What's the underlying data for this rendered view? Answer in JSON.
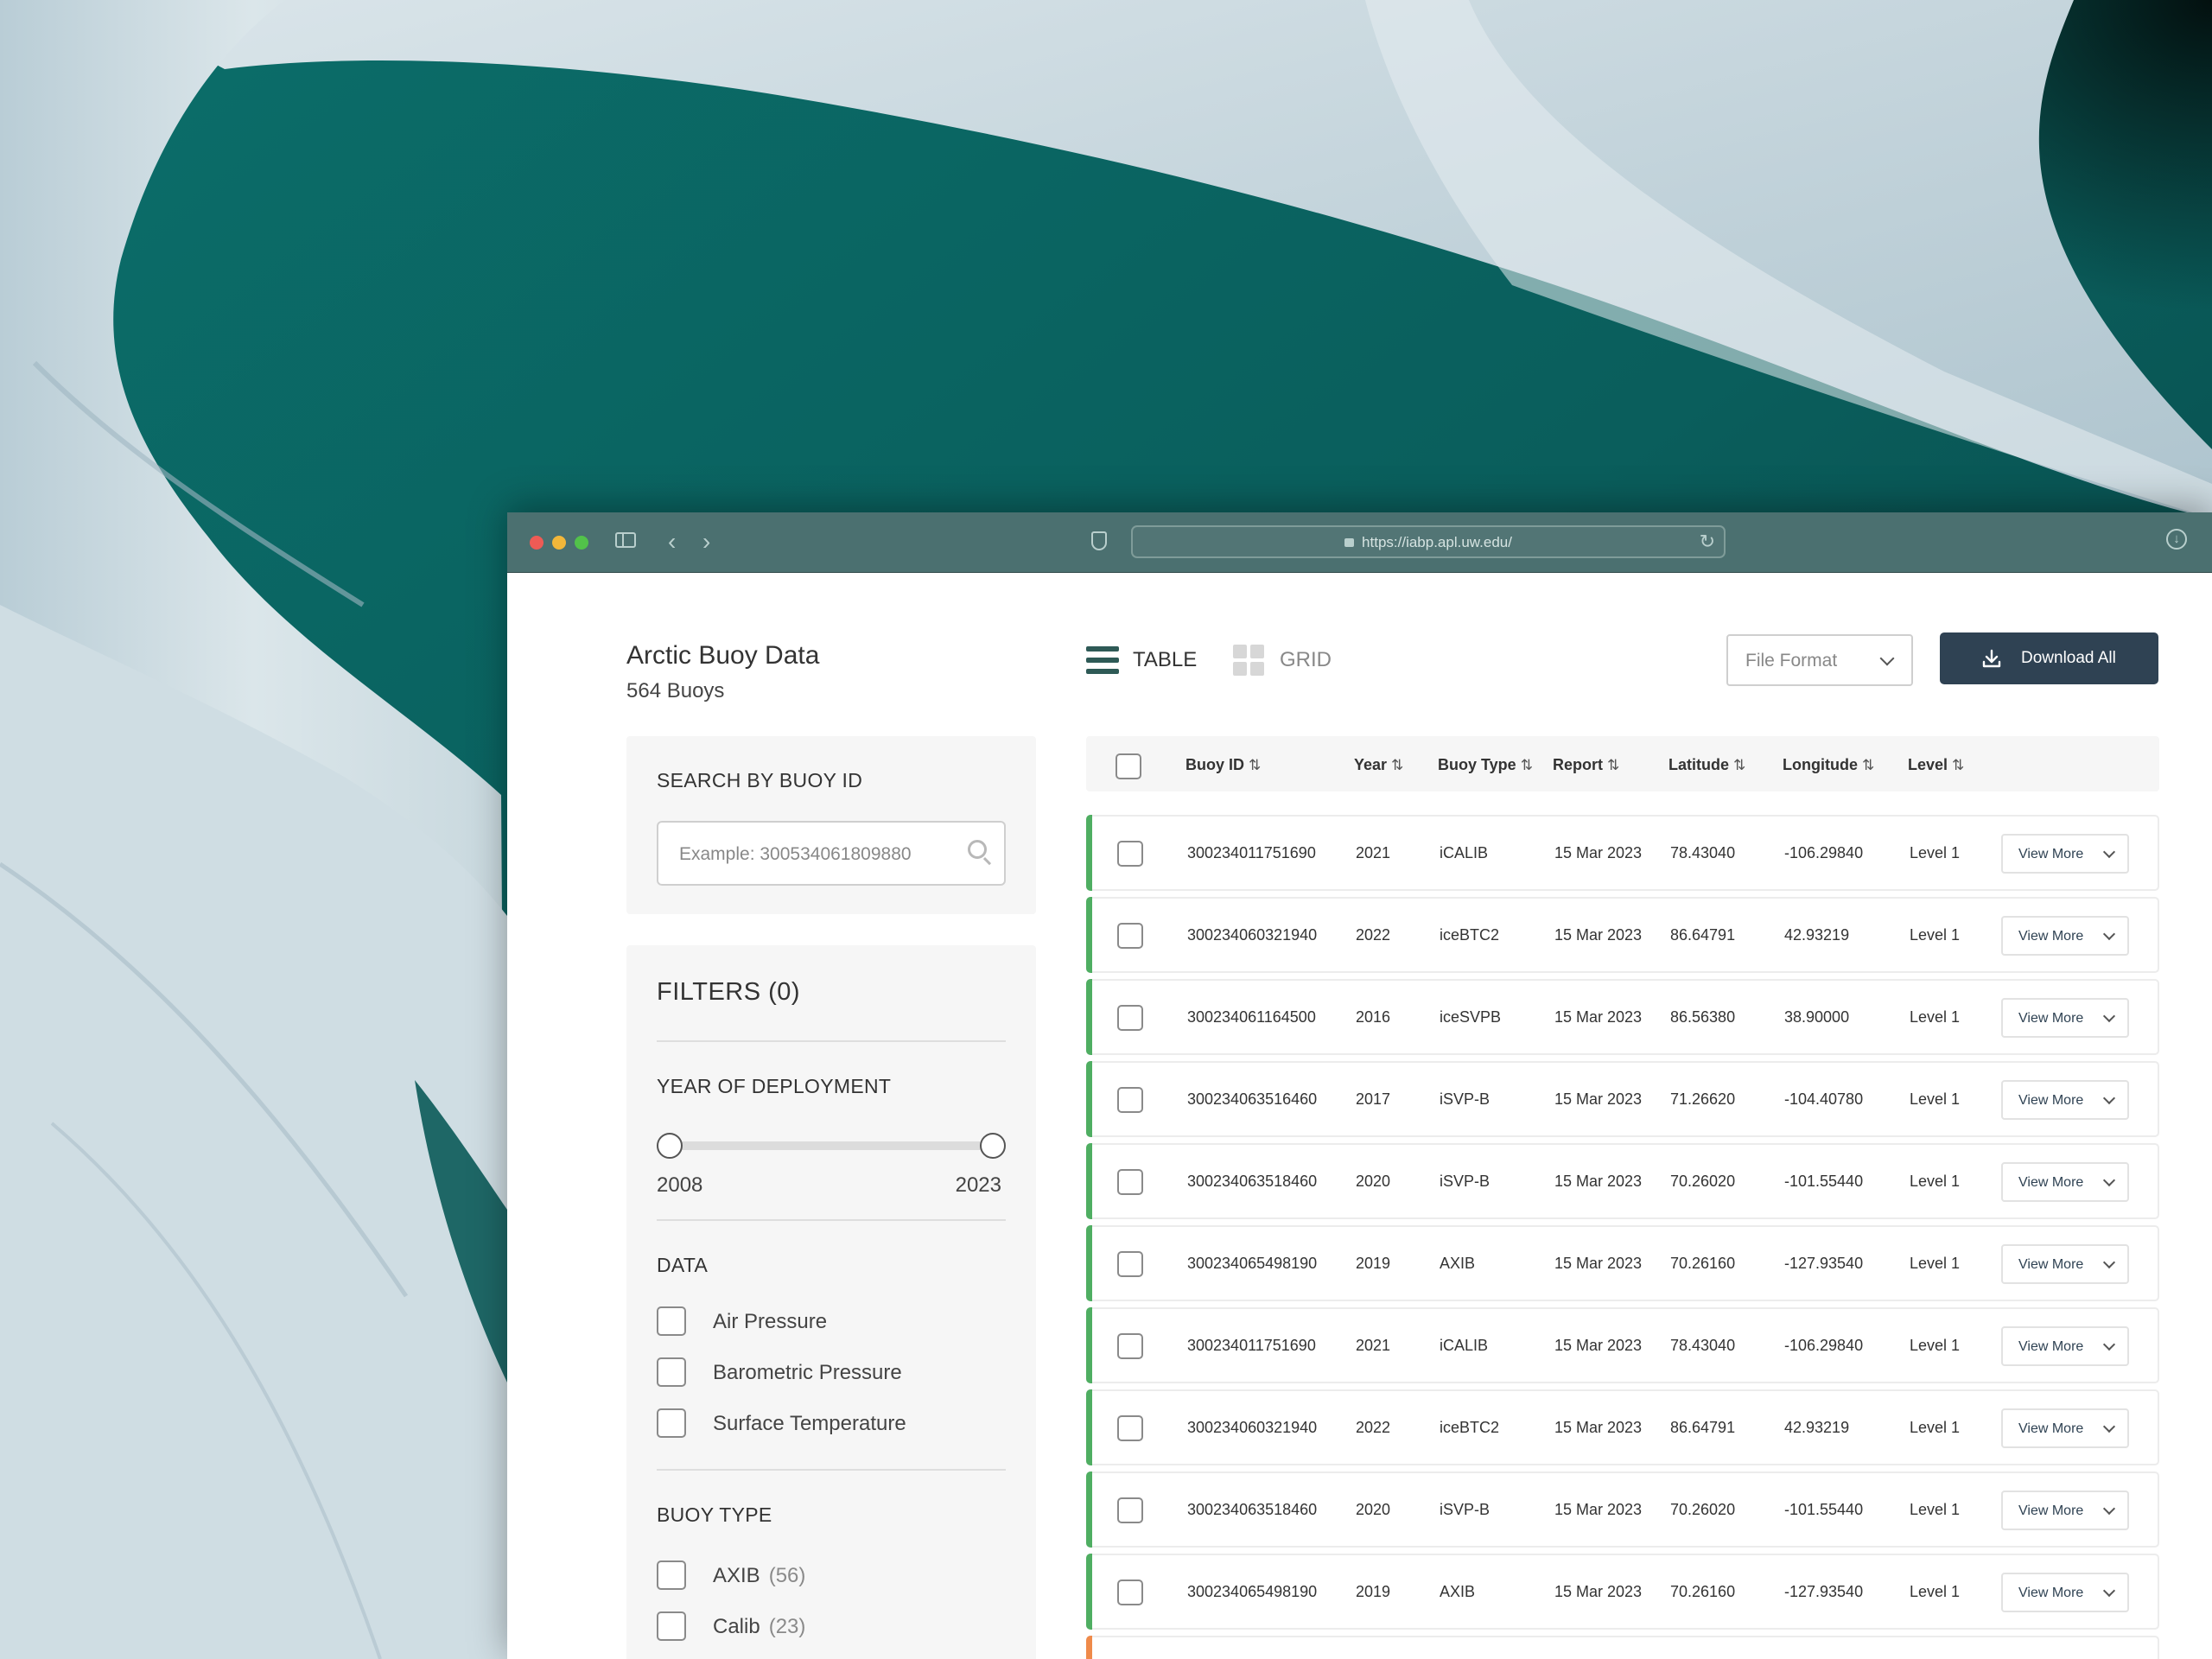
{
  "browser": {
    "url": "https://iabp.apl.uw.edu/"
  },
  "app": {
    "title": "Arctic Buoy Data",
    "count": "564 Buoys"
  },
  "search": {
    "heading": "SEARCH BY BUOY ID",
    "placeholder": "Example: 300534061809880"
  },
  "filters": {
    "title": "FILTERS (0)",
    "year": {
      "heading": "YEAR OF DEPLOYMENT",
      "min": "2008",
      "max": "2023"
    },
    "data": {
      "heading": "DATA",
      "options": [
        "Air Pressure",
        "Barometric Pressure",
        "Surface Temperature"
      ]
    },
    "buoy_type": {
      "heading": "BUOY TYPE",
      "options": [
        {
          "label": "AXIB",
          "count": "(56)"
        },
        {
          "label": "Calib",
          "count": "(23)"
        }
      ]
    }
  },
  "view_toggle": {
    "table": "TABLE",
    "grid": "GRID"
  },
  "toolbar": {
    "file_format": "File Format",
    "download_all": "Download All"
  },
  "table": {
    "headers": [
      "Buoy ID",
      "Year",
      "Buoy Type",
      "Report",
      "Latitude",
      "Longitude",
      "Level"
    ],
    "sort_glyph": "⇅",
    "view_more": "View More",
    "rows": [
      [
        "300234011751690",
        "2021",
        "iCALIB",
        "15 Mar 2023",
        "78.43040",
        "-106.29840",
        "Level 1"
      ],
      [
        "300234060321940",
        "2022",
        "iceBTC2",
        "15 Mar 2023",
        "86.64791",
        "42.93219",
        "Level 1"
      ],
      [
        "300234061164500",
        "2016",
        "iceSVPB",
        "15 Mar 2023",
        "86.56380",
        "38.90000",
        "Level 1"
      ],
      [
        "300234063516460",
        "2017",
        "iSVP-B",
        "15 Mar 2023",
        "71.26620",
        "-104.40780",
        "Level 1"
      ],
      [
        "300234063518460",
        "2020",
        "iSVP-B",
        "15 Mar 2023",
        "70.26020",
        "-101.55440",
        "Level 1"
      ],
      [
        "300234065498190",
        "2019",
        "AXIB",
        "15 Mar 2023",
        "70.26160",
        "-127.93540",
        "Level 1"
      ],
      [
        "300234011751690",
        "2021",
        "iCALIB",
        "15 Mar 2023",
        "78.43040",
        "-106.29840",
        "Level 1"
      ],
      [
        "300234060321940",
        "2022",
        "iceBTC2",
        "15 Mar 2023",
        "86.64791",
        "42.93219",
        "Level 1"
      ],
      [
        "300234063518460",
        "2020",
        "iSVP-B",
        "15 Mar 2023",
        "70.26020",
        "-101.55440",
        "Level 1"
      ],
      [
        "300234065498190",
        "2019",
        "AXIB",
        "15 Mar 2023",
        "70.26160",
        "-127.93540",
        "Level 1"
      ]
    ]
  },
  "colors": {
    "accent_green": "#4fae62",
    "accent_orange": "#ef8a4a",
    "button_dark": "#2f4253",
    "toggle_active": "#2e5a56"
  }
}
